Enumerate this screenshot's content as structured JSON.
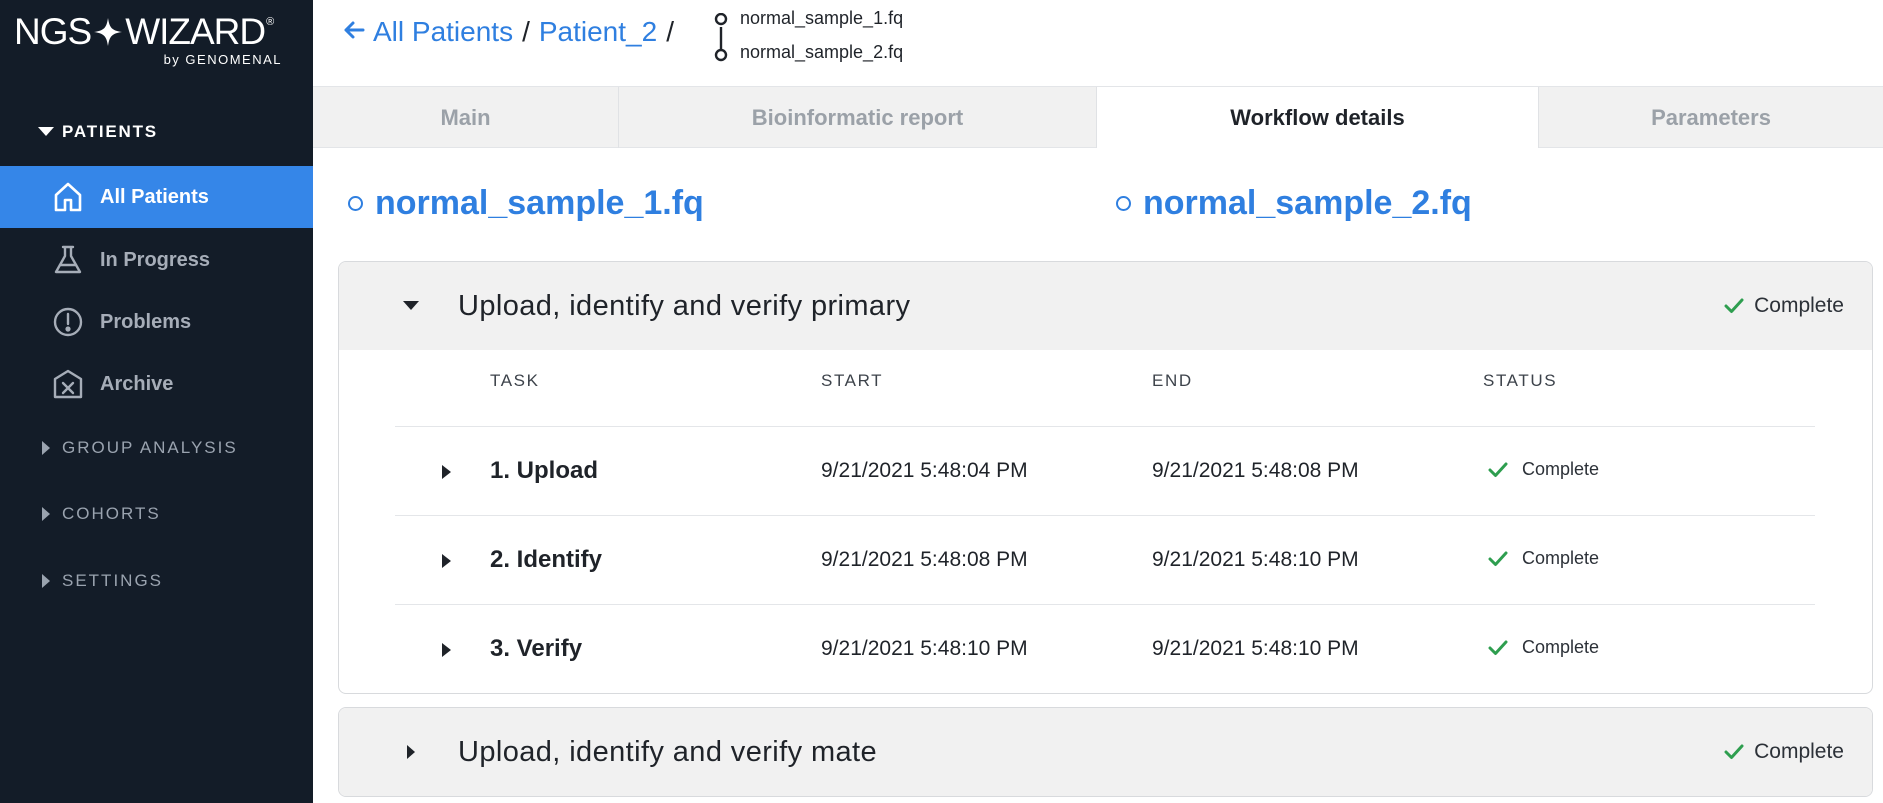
{
  "brand": {
    "logo_left": "NGS",
    "logo_right": "WIZARD",
    "logo_reg": "®",
    "logo_sub": "by GENOMENAL"
  },
  "sidebar": {
    "patients_label": "PATIENTS",
    "items": [
      {
        "label": "All Patients",
        "icon": "home-icon",
        "active": true
      },
      {
        "label": "In Progress",
        "icon": "flask-icon",
        "active": false
      },
      {
        "label": "Problems",
        "icon": "alert-circle-icon",
        "active": false
      },
      {
        "label": "Archive",
        "icon": "archive-box-icon",
        "active": false
      }
    ],
    "sections": [
      {
        "label": "GROUP ANALYSIS"
      },
      {
        "label": "COHORTS"
      },
      {
        "label": "SETTINGS"
      }
    ]
  },
  "breadcrumb": {
    "root": "All Patients",
    "patient": "Patient_2",
    "sep": "/",
    "files": [
      "normal_sample_1.fq",
      "normal_sample_2.fq"
    ]
  },
  "tabs": [
    {
      "label": "Main",
      "active": false
    },
    {
      "label": "Bioinformatic report",
      "active": false
    },
    {
      "label": "Workflow details",
      "active": true
    },
    {
      "label": "Parameters",
      "active": false
    }
  ],
  "samples": [
    "normal_sample_1.fq",
    "normal_sample_2.fq"
  ],
  "table_headers": [
    "TASK",
    "START",
    "END",
    "STATUS"
  ],
  "steps": [
    {
      "title": "Upload, identify and verify primary",
      "status": "Complete",
      "expanded": true,
      "tasks": [
        {
          "name": "1. Upload",
          "start": "9/21/2021 5:48:04 PM",
          "end": "9/21/2021 5:48:08 PM",
          "status": "Complete"
        },
        {
          "name": "2. Identify",
          "start": "9/21/2021 5:48:08 PM",
          "end": "9/21/2021 5:48:10 PM",
          "status": "Complete"
        },
        {
          "name": "3. Verify",
          "start": "9/21/2021 5:48:10 PM",
          "end": "9/21/2021 5:48:10 PM",
          "status": "Complete"
        }
      ]
    },
    {
      "title": "Upload, identify and verify mate",
      "status": "Complete",
      "expanded": false,
      "tasks": []
    }
  ],
  "colors": {
    "accent": "#2f7fe0",
    "sidebar_bg": "#131c28",
    "success": "#2e9e4f"
  }
}
